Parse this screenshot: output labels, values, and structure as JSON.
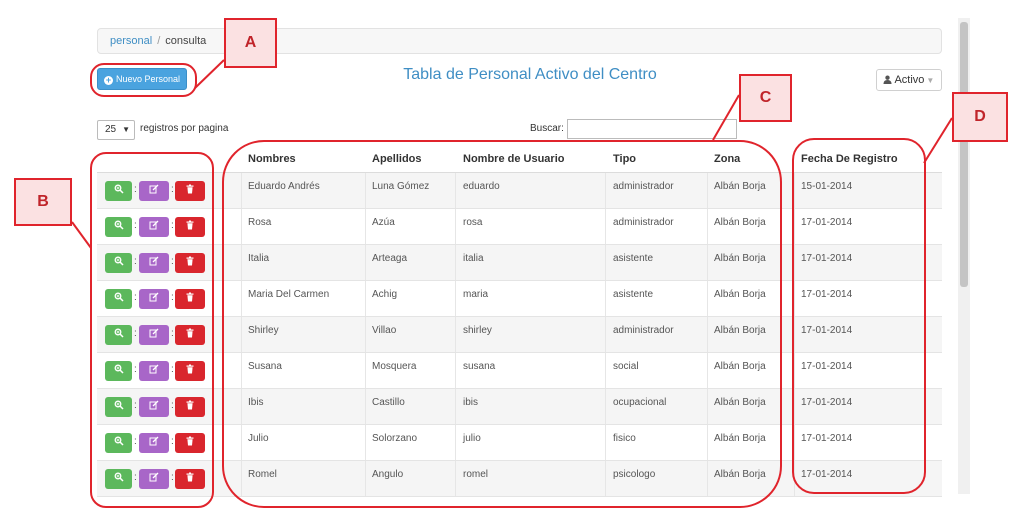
{
  "breadcrumb": {
    "link": "personal",
    "separator": "/",
    "current": "consulta"
  },
  "toolbar": {
    "new_button_label": "Nuevo Personal",
    "title": "Tabla de Personal Activo del Centro",
    "status_dropdown": "Activo"
  },
  "controls": {
    "page_length": "25",
    "page_length_label": "registros por pagina",
    "search_label": "Buscar:",
    "search_value": ""
  },
  "table": {
    "headers": {
      "nombres": "Nombres",
      "apellidos": "Apellidos",
      "usuario": "Nombre de Usuario",
      "tipo": "Tipo",
      "zona": "Zona",
      "fecha": "Fecha De Registro"
    },
    "action_separator": ":",
    "rows": [
      {
        "nombres": "Eduardo Andrés",
        "apellidos": "Luna Gómez",
        "usuario": "eduardo",
        "tipo": "administrador",
        "zona": "Albán Borja",
        "fecha": "15-01-2014"
      },
      {
        "nombres": "Rosa",
        "apellidos": "Azúa",
        "usuario": "rosa",
        "tipo": "administrador",
        "zona": "Albán Borja",
        "fecha": "17-01-2014"
      },
      {
        "nombres": "Italia",
        "apellidos": "Arteaga",
        "usuario": "italia",
        "tipo": "asistente",
        "zona": "Albán Borja",
        "fecha": "17-01-2014"
      },
      {
        "nombres": "Maria Del Carmen",
        "apellidos": "Achig",
        "usuario": "maria",
        "tipo": "asistente",
        "zona": "Albán Borja",
        "fecha": "17-01-2014"
      },
      {
        "nombres": "Shirley",
        "apellidos": "Villao",
        "usuario": "shirley",
        "tipo": "administrador",
        "zona": "Albán Borja",
        "fecha": "17-01-2014"
      },
      {
        "nombres": "Susana",
        "apellidos": "Mosquera",
        "usuario": "susana",
        "tipo": "social",
        "zona": "Albán Borja",
        "fecha": "17-01-2014"
      },
      {
        "nombres": "Ibis",
        "apellidos": "Castillo",
        "usuario": "ibis",
        "tipo": "ocupacional",
        "zona": "Albán Borja",
        "fecha": "17-01-2014"
      },
      {
        "nombres": "Julio",
        "apellidos": "Solorzano",
        "usuario": "julio",
        "tipo": "fisico",
        "zona": "Albán Borja",
        "fecha": "17-01-2014"
      },
      {
        "nombres": "Romel",
        "apellidos": "Angulo",
        "usuario": "romel",
        "tipo": "psicologo",
        "zona": "Albán Borja",
        "fecha": "17-01-2014"
      }
    ]
  },
  "icons": {
    "view": "zoom-in-icon",
    "edit": "edit-icon",
    "delete": "trash-icon",
    "user": "user-icon",
    "add": "plus-circle-icon"
  },
  "colors": {
    "accent": "#3f8ec4",
    "new_button": "#4aa3df",
    "view_button": "#5cb85c",
    "edit_button": "#a866c8",
    "delete_button": "#d9262d",
    "callout": "#e0242c",
    "callout_fill": "#fbe1e2"
  },
  "callouts": {
    "a": "A",
    "b": "B",
    "c": "C",
    "d": "D"
  }
}
